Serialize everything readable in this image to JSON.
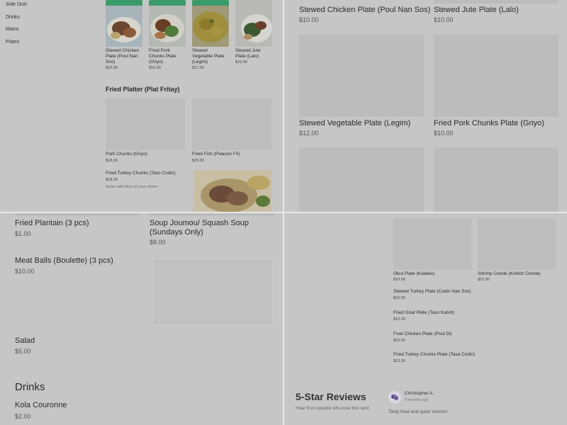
{
  "colors": {
    "overlay": "#c6c6c6",
    "placeholder": "#bcbcbc",
    "divider": "#e6e6e6",
    "badge": "#2f9a63"
  },
  "q1": {
    "categories": [
      "Side Dish",
      "Drinks",
      "Mains",
      "Plates"
    ],
    "plates": [
      {
        "name": "Stewed Chicken Plate (Poul Nan Sos)",
        "price": "$10.00"
      },
      {
        "name": "Fried Pork Chunks Plate (Griyo)",
        "price": "$10.00"
      },
      {
        "name": "Stewed Vegetable Plate (Legim)",
        "price": "$12.00"
      },
      {
        "name": "Stewed Jute Plate (Lalo)",
        "price": "$10.00"
      }
    ],
    "fried_platter_title": "Fried Platter (Plat Fritay)",
    "fp_items": [
      {
        "name": "Pork Chunks (Griyo)",
        "price": "$18.00"
      },
      {
        "name": "Fried Fish (Pwason Fri)",
        "price": "$25.00"
      }
    ],
    "turkey": {
      "name": "Fried Turkey Chunks (Taso Codin)",
      "price": "$18.00",
      "desc": "Serve with Rice of your choice"
    }
  },
  "q2": {
    "items": [
      {
        "name": "Stewed Chicken Plate (Poul Nan Sos)",
        "price": "$10.00"
      },
      {
        "name": "Stewed Jute Plate (Lalo)",
        "price": "$10.00"
      },
      {
        "name": "Stewed Vegetable Plate (Legim)",
        "price": "$12.00"
      },
      {
        "name": "Fried Pork Chunks Plate (Griyo)",
        "price": "$10.00"
      }
    ]
  },
  "q3": {
    "items": [
      {
        "name": "Fried Plantain (3 pcs)",
        "price": "$1.00"
      },
      {
        "name": "Soup Joumou/ Squash Soup (Sundays Only)",
        "price": "$8.00"
      },
      {
        "name": "Meat Balls (Boulette) (3 pcs)",
        "price": "$10.00"
      },
      {
        "name": "Salad",
        "price": "$5.00"
      }
    ],
    "drinks_heading": "Drinks",
    "drink": {
      "name": "Kola Couronne",
      "price": "$2.00"
    }
  },
  "q4": {
    "cards": [
      {
        "name": "Okra Plate (Kalalou)",
        "price": "$10.00"
      },
      {
        "name": "Shrimp Creole (Kribich Creole)",
        "price": "$12.00"
      }
    ],
    "list": [
      {
        "name": "Stewed Turkey Plate (Codin Nan Sos)",
        "price": "$10.00"
      },
      {
        "name": "Fried Goat Plate (Taso Kabrit)",
        "price": "$12.00"
      },
      {
        "name": "Fowl Chicken Plate (Poul Di)",
        "price": "$10.00"
      },
      {
        "name": "Fried Turkey Chunks Plate (Tasa Codin)",
        "price": "$10.00"
      }
    ],
    "reviews": {
      "title": "5-Star Reviews",
      "subtitle": "Hear from people who love this spot",
      "reviewer": "Christopher A.",
      "time": "9 months ago",
      "text": "Tasty food and quick service!"
    }
  }
}
